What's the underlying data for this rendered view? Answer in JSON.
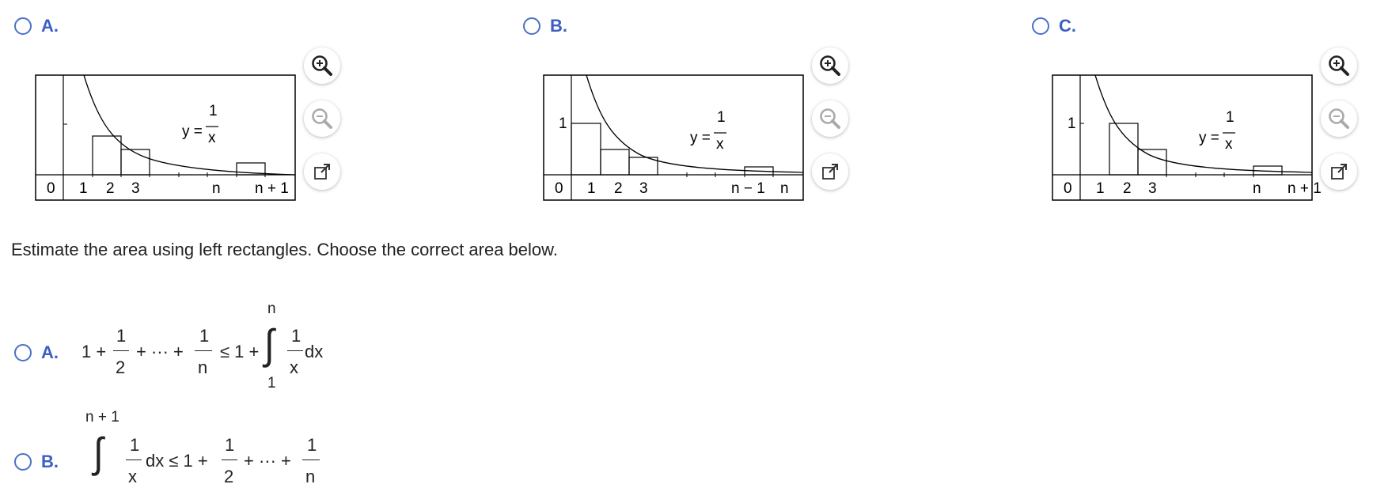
{
  "graph_options": [
    {
      "letter": "A.",
      "curve_label_lhs": "y =",
      "curve_label_num": "1",
      "curve_label_den": "x",
      "ticks": [
        "0",
        "1",
        "2",
        "3",
        "n",
        "n + 1"
      ],
      "y_tick": ""
    },
    {
      "letter": "B.",
      "curve_label_lhs": "y =",
      "curve_label_num": "1",
      "curve_label_den": "x",
      "ticks": [
        "0",
        "1",
        "2",
        "3",
        "n − 1",
        "n"
      ],
      "y_tick": "1"
    },
    {
      "letter": "C.",
      "curve_label_lhs": "y =",
      "curve_label_num": "1",
      "curve_label_den": "x",
      "ticks": [
        "0",
        "1",
        "2",
        "3",
        "n",
        "n + 1"
      ],
      "y_tick": "1"
    }
  ],
  "tools": {
    "zoom_in": "zoom-in-icon",
    "zoom_out": "zoom-out-icon",
    "popout": "popout-icon"
  },
  "prompt": "Estimate the area using left rectangles. Choose the correct area below.",
  "answers": {
    "a": {
      "letter": "A.",
      "one": "1 +",
      "f1_num": "1",
      "f1_den": "2",
      "dots": "+ ··· +",
      "f2_num": "1",
      "f2_den": "n",
      "le": "≤ 1 +",
      "int_upper": "n",
      "int_lower": "1",
      "f3_num": "1",
      "f3_den": "x",
      "dx": "dx"
    },
    "b": {
      "letter": "B.",
      "int_upper": "n + 1",
      "f1_num": "1",
      "f1_den": "x",
      "dx_le": "dx ≤ 1 +",
      "f2_num": "1",
      "f2_den": "2",
      "dots": "+ ··· +",
      "f3_num": "1",
      "f3_den": "n"
    }
  },
  "colors": {
    "accent": "#3b5fc2",
    "radio": "#4a70c8"
  }
}
